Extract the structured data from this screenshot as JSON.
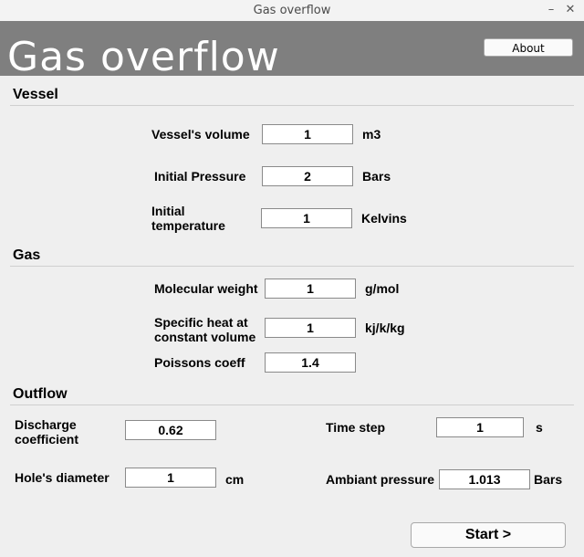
{
  "window": {
    "title": "Gas overflow",
    "minimize": "–",
    "close": "✕"
  },
  "banner": {
    "logo_text": "Gas overflow",
    "about_label": "About"
  },
  "vessel": {
    "heading": "Vessel",
    "volume": {
      "label": "Vessel's volume",
      "value": "1",
      "unit": "m3"
    },
    "pressure": {
      "label": "Initial Pressure",
      "value": "2",
      "unit": "Bars"
    },
    "temperature": {
      "label_line1": "Initial",
      "label_line2": "temperature",
      "value": "1",
      "unit": "Kelvins"
    }
  },
  "gas": {
    "heading": "Gas",
    "molecular_weight": {
      "label": "Molecular weight",
      "value": "1",
      "unit": "g/mol"
    },
    "specific_heat": {
      "label_line1": "Specific heat at",
      "label_line2": "constant volume",
      "value": "1",
      "unit": "kj/k/kg"
    },
    "poissons": {
      "label": "Poissons coeff",
      "value": "1.4"
    }
  },
  "outflow": {
    "heading": "Outflow",
    "discharge": {
      "label_line1": "Discharge",
      "label_line2": "coefficient",
      "value": "0.62"
    },
    "time_step": {
      "label": "Time step",
      "value": "1",
      "unit": "s"
    },
    "hole_diameter": {
      "label": "Hole's diameter",
      "value": "1",
      "unit": "cm"
    },
    "ambient_pressure": {
      "label": "Ambiant pressure",
      "value": "1.013",
      "unit": "Bars"
    }
  },
  "start_label": "Start  >"
}
